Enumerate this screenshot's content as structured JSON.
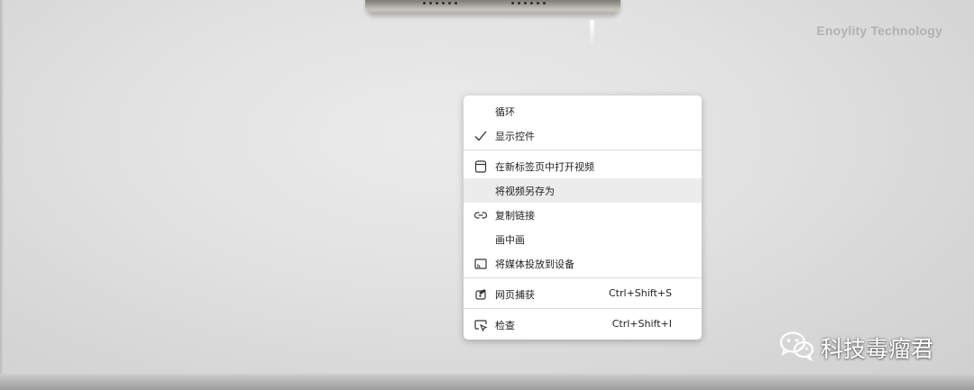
{
  "brand": {
    "text": "Enoylity Technology"
  },
  "context_menu": {
    "items": [
      {
        "label": "循环",
        "shortcut": ""
      },
      {
        "label": "显示控件",
        "shortcut": "",
        "checked": true
      },
      {
        "label": "在新标签页中打开视频",
        "shortcut": ""
      },
      {
        "label": "将视频另存为",
        "shortcut": ""
      },
      {
        "label": "复制链接",
        "shortcut": ""
      },
      {
        "label": "画中画",
        "shortcut": ""
      },
      {
        "label": "将媒体投放到设备",
        "shortcut": ""
      },
      {
        "label": "网页捕获",
        "shortcut": "Ctrl+Shift+S"
      },
      {
        "label": "检查",
        "shortcut": "Ctrl+Shift+I"
      }
    ],
    "highlighted": "将视频另存为"
  },
  "watermark": {
    "text": "科技毒瘤君",
    "icon": "wechat-icon"
  },
  "colors": {
    "menu_bg": "#ffffff",
    "hover_bg": "#ececec",
    "text": "#1f1f1f"
  }
}
